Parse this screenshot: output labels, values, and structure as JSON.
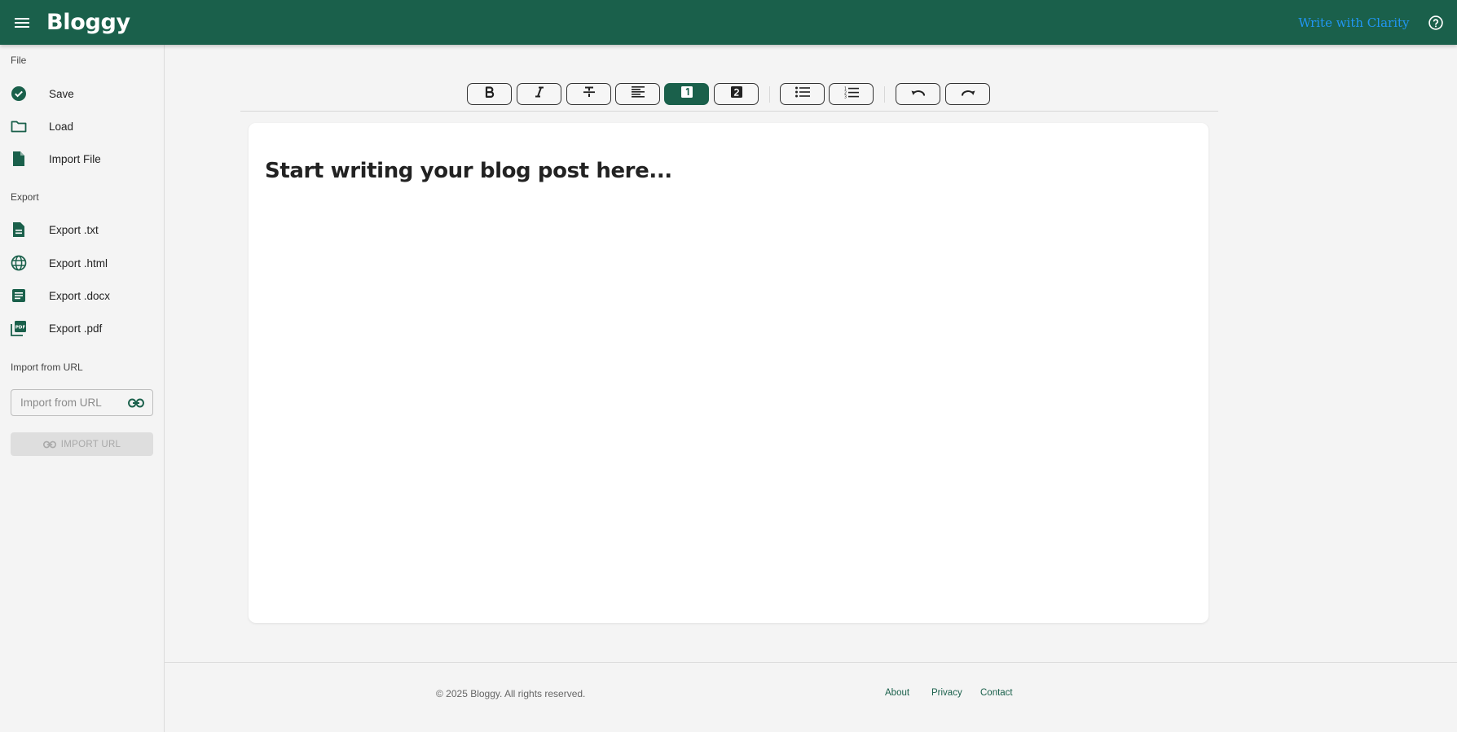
{
  "app": {
    "brand": "Bloggy",
    "clarity_link": "Write with Clarity",
    "colors": {
      "primary": "#1a604b",
      "link": "#2196f3",
      "background": "#f4f4f4"
    }
  },
  "sidebar": {
    "file_label": "File",
    "file_items": [
      {
        "label": "Save",
        "icon": "check-circle-icon"
      },
      {
        "label": "Load",
        "icon": "folder-icon"
      },
      {
        "label": "Import File",
        "icon": "file-icon"
      }
    ],
    "export_label": "Export",
    "export_items": [
      {
        "label": "Export .txt",
        "icon": "text-file-icon"
      },
      {
        "label": "Export .html",
        "icon": "globe-icon"
      },
      {
        "label": "Export .docx",
        "icon": "document-icon"
      },
      {
        "label": "Export .pdf",
        "icon": "pdf-icon"
      }
    ],
    "url_section_label": "Import from URL",
    "url_placeholder": "Import from URL",
    "import_url_button": "IMPORT URL"
  },
  "toolbar": {
    "buttons": [
      {
        "name": "bold",
        "icon": "bold-icon",
        "active": false
      },
      {
        "name": "italic",
        "icon": "italic-icon",
        "active": false
      },
      {
        "name": "strikethrough",
        "icon": "strikethrough-icon",
        "active": false
      },
      {
        "name": "align-left",
        "icon": "align-left-icon",
        "active": false
      },
      {
        "name": "heading-1",
        "icon": "heading-1-icon",
        "active": true
      },
      {
        "name": "heading-2",
        "icon": "heading-2-icon",
        "active": false
      },
      {
        "name": "bullet-list",
        "icon": "bullet-list-icon",
        "active": false
      },
      {
        "name": "numbered-list",
        "icon": "numbered-list-icon",
        "active": false
      },
      {
        "name": "undo",
        "icon": "undo-icon",
        "active": false
      },
      {
        "name": "redo",
        "icon": "redo-icon",
        "active": false
      }
    ]
  },
  "editor": {
    "heading": "Start writing your blog post here..."
  },
  "footer": {
    "copyright": "© 2025 Bloggy. All rights reserved.",
    "links": [
      "About",
      "Privacy",
      "Contact"
    ]
  }
}
